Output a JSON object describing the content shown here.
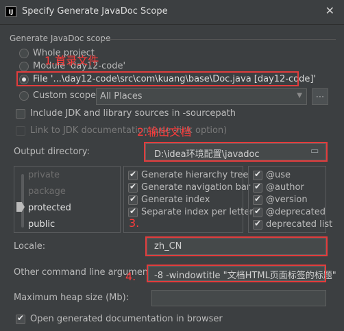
{
  "window": {
    "title": "Specify Generate JavaDoc Scope",
    "close_glyph": "✕",
    "icon_text": "IJ"
  },
  "scope": {
    "title": "Generate JavaDoc scope",
    "options": [
      {
        "label": "Whole project",
        "selected": false
      },
      {
        "label": "Module 'day12-code'",
        "selected": false
      },
      {
        "label": "File '...\\day12-code\\src\\com\\kuang\\base\\Doc.java [day12-code]'",
        "selected": true
      },
      {
        "label": "Custom scope",
        "selected": false
      }
    ],
    "custom_scope_value": "All Places",
    "browse_label": "..."
  },
  "include_jdk": {
    "label": "Include JDK and library sources in -sourcepath",
    "checked": false
  },
  "link_jdk": {
    "label": "Link to JDK documentation (use -link option)",
    "checked": false,
    "enabled": false
  },
  "output": {
    "label": "Output directory:",
    "value": "D:\\idea环境配置\\javadoc"
  },
  "visibility": {
    "levels": [
      "private",
      "package",
      "protected",
      "public"
    ],
    "selected": "protected"
  },
  "generate_options": [
    {
      "label": "Generate hierarchy tree",
      "checked": true
    },
    {
      "label": "Generate navigation bar",
      "checked": true
    },
    {
      "label": "Generate index",
      "checked": true
    },
    {
      "label": "Separate index per letter",
      "checked": true
    }
  ],
  "tags": [
    {
      "label": "@use",
      "checked": true
    },
    {
      "label": "@author",
      "checked": true
    },
    {
      "label": "@version",
      "checked": true
    },
    {
      "label": "@deprecated",
      "checked": true
    },
    {
      "label": "deprecated list",
      "checked": true
    }
  ],
  "locale": {
    "label": "Locale:",
    "value": "zh_CN"
  },
  "other_args": {
    "label": "Other command line arguments:",
    "value": "-8 -windowtitle \"文档HTML页面标签的标题\""
  },
  "heap": {
    "label": "Maximum heap size (Mb):",
    "value": ""
  },
  "open_browser": {
    "label": "Open generated documentation in browser",
    "checked": true
  },
  "annotations": {
    "a1": "1.首录文件",
    "a2": "2.输出文档",
    "a3": "3.",
    "a4": "4."
  },
  "colors": {
    "annotation": "#ff3b3b",
    "background": "#3c3f41",
    "field": "#45494a"
  }
}
